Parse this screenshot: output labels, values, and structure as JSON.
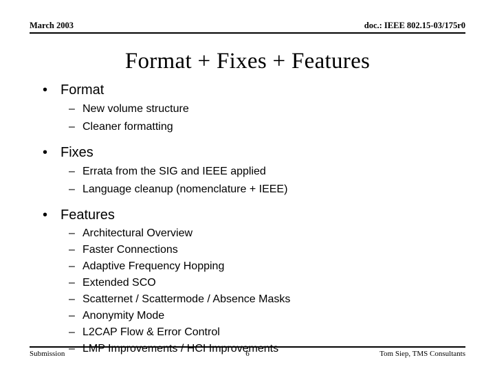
{
  "slide": {
    "header": {
      "left": "March 2003",
      "right": "doc.: IEEE 802.15-03/175r0"
    },
    "title": "Format + Fixes + Features",
    "bullet_glyph": "•",
    "dash_glyph": "–",
    "sections": [
      {
        "heading": "Format",
        "items": [
          "New volume structure",
          "Cleaner formatting"
        ]
      },
      {
        "heading": "Fixes",
        "items": [
          "Errata from the SIG and IEEE applied",
          "Language cleanup (nomenclature + IEEE)"
        ]
      },
      {
        "heading": "Features",
        "items": [
          "Architectural Overview",
          "Faster Connections",
          "Adaptive Frequency Hopping",
          "Extended SCO",
          "Scatternet / Scattermode / Absence Masks",
          "Anonymity Mode",
          "L2CAP Flow & Error Control",
          "LMP Improvements / HCI Improvements"
        ]
      }
    ],
    "footer": {
      "left": "Submission",
      "page": "6",
      "right": "Tom Siep, TMS Consultants"
    },
    "colors": {
      "text": "#000000",
      "background": "#ffffff",
      "rule": "#000000"
    }
  }
}
